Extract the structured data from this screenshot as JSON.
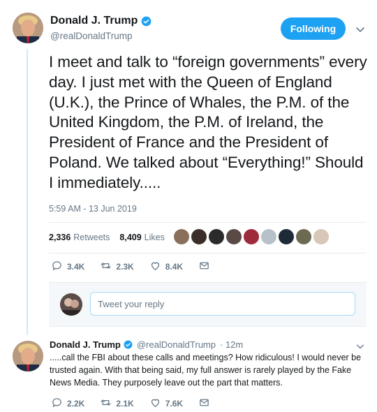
{
  "tweet": {
    "author_name": "Donald J. Trump",
    "author_handle": "@realDonaldTrump",
    "follow_label": "Following",
    "text": "I meet and talk to “foreign governments” every day. I just met with the Queen of England (U.K.), the Prince of Whales, the P.M. of the United Kingdom, the P.M. of Ireland, the President of France and the President of Poland. We talked about “Everything!” Should I immediately.....",
    "timestamp": "5:59 AM - 13 Jun 2019",
    "retweets_count": "2,336",
    "retweets_label": "Retweets",
    "likes_count": "8,409",
    "likes_label": "Likes",
    "actions": {
      "replies": "3.4K",
      "retweets": "2.3K",
      "likes": "8.4K"
    }
  },
  "reply_composer": {
    "placeholder": "Tweet your reply"
  },
  "thread_reply": {
    "author_name": "Donald J. Trump",
    "author_handle": "@realDonaldTrump",
    "time": "· 12m",
    "text": ".....call the FBI about these calls and meetings? How ridiculous! I would never be trusted again. With that being said, my full answer is rarely played by the Fake News Media. They purposely leave out the part that matters.",
    "actions": {
      "replies": "2.2K",
      "retweets": "2.1K",
      "likes": "7.6K"
    }
  },
  "colors": {
    "accent": "#1da1f2",
    "muted": "#657786",
    "text": "#14171a",
    "thread_line": "#cfe6f7"
  },
  "icons": [
    "verified-icon",
    "chevron-down-icon",
    "reply-icon",
    "retweet-icon",
    "like-icon",
    "message-icon"
  ]
}
